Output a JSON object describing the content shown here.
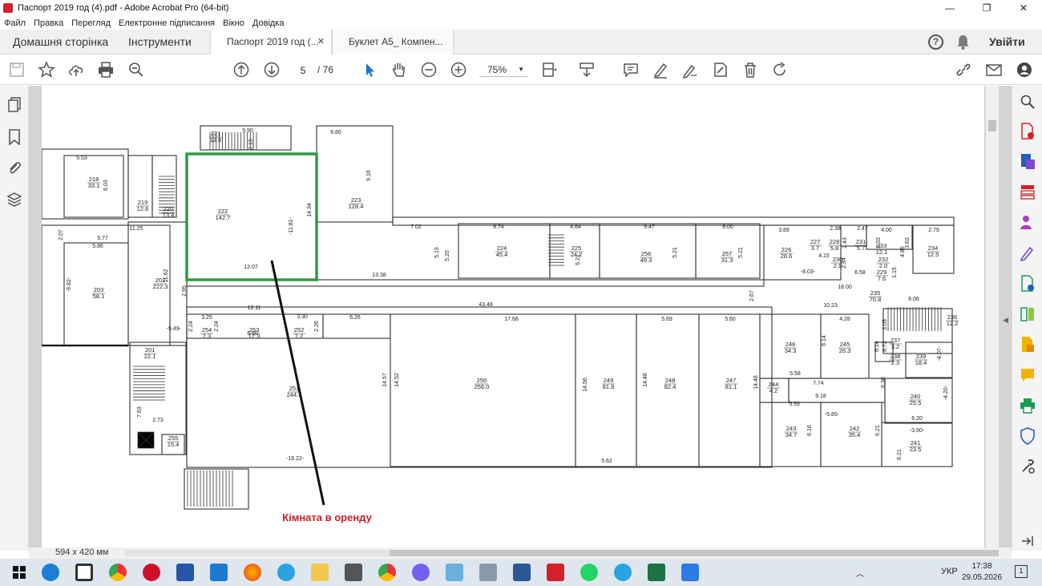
{
  "window": {
    "title": "Паспорт 2019 год (4).pdf - Adobe Acrobat Pro (64-bit)",
    "minimize": "—",
    "maximize": "❐",
    "close": "✕"
  },
  "menu": [
    "Файл",
    "Правка",
    "Перегляд",
    "Електронне підписання",
    "Вікно",
    "Довідка"
  ],
  "tabs": {
    "home": "Домашня сторінка",
    "tools": "Інструменти",
    "doc1": "Паспорт 2019 год (...",
    "doc2": "Буклет А5_ Компен...",
    "close_glyph": "✕"
  },
  "header": {
    "help": "?",
    "signin": "Увійти"
  },
  "toolbar": {
    "page_current": "5",
    "page_total": "/ 76",
    "zoom": "75%"
  },
  "status": {
    "page_size": "594 x 420 мм"
  },
  "plan": {
    "annotation": "Кімната в оренду",
    "highlight_color": "#2e9b45",
    "rooms": [
      {
        "no": "221",
        "area": "12.6"
      },
      {
        "no": "218",
        "area": "33.1"
      },
      {
        "no": "219",
        "area": "12.6"
      },
      {
        "no": "220",
        "area": "13.4"
      },
      {
        "no": "222",
        "area": "142.7"
      },
      {
        "no": "223",
        "area": "128.4"
      },
      {
        "no": "224",
        "area": "45.4"
      },
      {
        "no": "225",
        "area": "24.2"
      },
      {
        "no": "256",
        "area": "49.3"
      },
      {
        "no": "257",
        "area": "31.3"
      },
      {
        "no": "226",
        "area": "28.6"
      },
      {
        "no": "227",
        "area": "3.7"
      },
      {
        "no": "228",
        "area": "5.8"
      },
      {
        "no": "231",
        "area": "5.7"
      },
      {
        "no": "233",
        "area": "12.1"
      },
      {
        "no": "234",
        "area": "12.5"
      },
      {
        "no": "230",
        "area": "2.9"
      },
      {
        "no": "232",
        "area": "2.0"
      },
      {
        "no": "229",
        "area": "7.6"
      },
      {
        "no": "203",
        "area": "58.1"
      },
      {
        "no": "202",
        "area": "222.3"
      },
      {
        "no": "235",
        "area": "70.8"
      },
      {
        "no": "254",
        "area": "7.3"
      },
      {
        "no": "253",
        "area": "12.3"
      },
      {
        "no": "252",
        "area": "7.2"
      },
      {
        "no": "236",
        "area": "12.2"
      },
      {
        "no": "201",
        "area": "22.1"
      },
      {
        "no": "246",
        "area": "34.3"
      },
      {
        "no": "245",
        "area": "26.3"
      },
      {
        "no": "237",
        "area": "3.2"
      },
      {
        "no": "238",
        "area": "2.3"
      },
      {
        "no": "239",
        "area": "18.4"
      },
      {
        "no": "251",
        "area": "244.3"
      },
      {
        "no": "250",
        "area": "256.0"
      },
      {
        "no": "249",
        "area": "81.8"
      },
      {
        "no": "248",
        "area": "82.4"
      },
      {
        "no": "247",
        "area": "81.1"
      },
      {
        "no": "244",
        "area": "4.2"
      },
      {
        "no": "240",
        "area": "25.5"
      },
      {
        "no": "243",
        "area": "34.7"
      },
      {
        "no": "242",
        "area": "35.4"
      },
      {
        "no": "241",
        "area": "23.5"
      },
      {
        "no": "255",
        "area": "15.4"
      }
    ],
    "dims": [
      "5.95",
      "2.15",
      "6.80",
      "5.53",
      "6.03",
      "9.16",
      "14.34",
      "-11.81-",
      "11.25",
      "5.77",
      "5.86",
      "-9.82-",
      "2.07",
      "12.07",
      "11.62",
      "7.02",
      "5.19",
      "5.20",
      "8.74",
      "4.64",
      "5.21",
      "9.47",
      "5.21",
      "6.00",
      "5.21",
      "3.89",
      "2.38",
      "2.47",
      "4.00",
      "2.79",
      "2.43",
      "2.33",
      "3.63",
      "4.85",
      "4.15",
      "2.34",
      "-8.03-",
      "6.58",
      "1.15",
      "13.38",
      "18.00",
      "2.95",
      "43.48",
      "2.67",
      "10.23",
      "6.06",
      "3.25",
      "2.24",
      "2.24",
      "12.11",
      "3.30",
      "2.26",
      "6.26",
      "17.68",
      "5.69",
      "5.60",
      "4.28",
      "3.05",
      "-5.49-",
      "5.50",
      "6.14",
      "6.14",
      "6.72",
      "-4.07-",
      "14.57",
      "14.52",
      "14.56",
      "14.48",
      "14.48",
      "5.58",
      "7.74",
      "6.36",
      "9.18",
      "-4.20-",
      "5.59",
      "-5.85-",
      "6.20",
      "6.16",
      "6.21",
      "6.21",
      "-3.90-",
      "7.63",
      "2.73",
      "-19.22-",
      "5.62"
    ]
  },
  "taskbar": {
    "lang": "УКР",
    "time": "17:38",
    "date": "29.05.2026",
    "notif": "1",
    "apps": [
      "start",
      "edge",
      "store",
      "chrome",
      "opera",
      "app-a",
      "outlook",
      "firefox",
      "telegram",
      "explorer",
      "calculator",
      "chrome-2",
      "viber",
      "app-b",
      "app-c",
      "word",
      "acrobat",
      "whatsapp",
      "telegram-2",
      "excel",
      "app-d"
    ]
  }
}
